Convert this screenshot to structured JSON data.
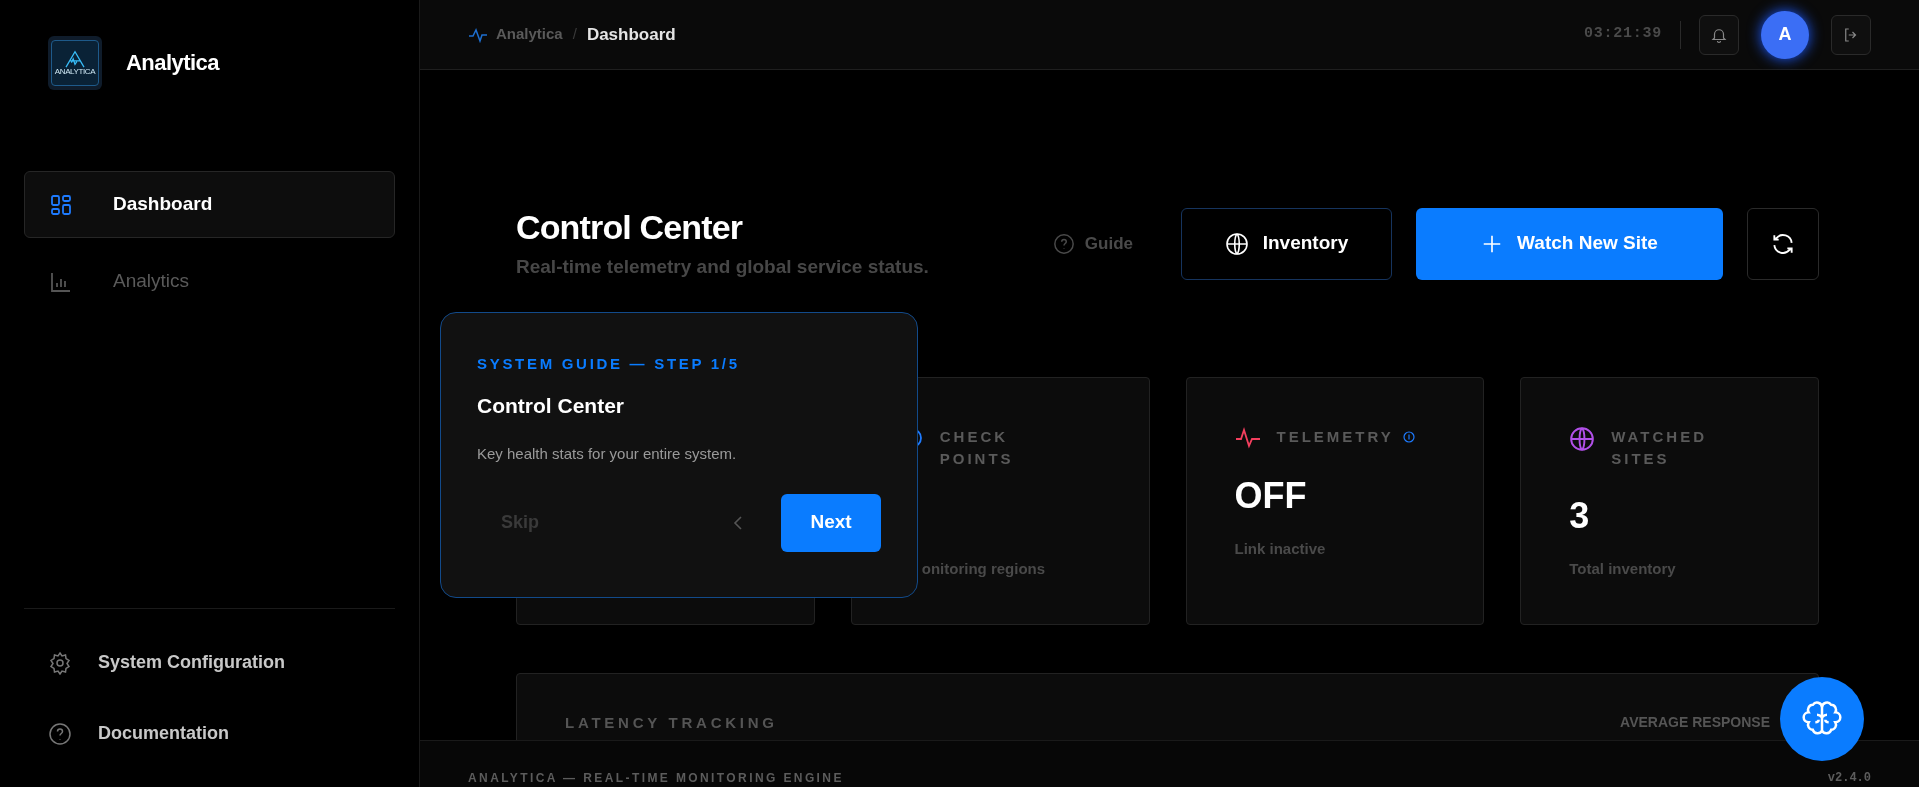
{
  "sidebar": {
    "brand": "Analytica",
    "logo_caption": "ANALYTICA",
    "nav": [
      {
        "label": "Dashboard",
        "selected": true
      },
      {
        "label": "Analytics",
        "selected": false
      }
    ],
    "bottom_links": [
      {
        "label": "System Configuration"
      },
      {
        "label": "Documentation"
      }
    ]
  },
  "header": {
    "breadcrumb": [
      "Analytica",
      "Dashboard"
    ],
    "separator": "/",
    "clock": "03:21:39",
    "avatar": "A"
  },
  "page": {
    "title": "Control Center",
    "subtitle": "Real-time telemetry and global service status.",
    "guide": "Guide",
    "inventory_button": "Inventory",
    "primary_button": "Watch New Site"
  },
  "stats": [
    {
      "kind": "covered"
    },
    {
      "kind": "stat",
      "label": "CHECK POINTS",
      "caption": "onitoring regions",
      "color": "#1e7bff",
      "info": false
    },
    {
      "kind": "stat",
      "label": "TELEMETRY",
      "value": "OFF",
      "caption": "Link inactive",
      "color": "#f43f5e",
      "info": true
    },
    {
      "kind": "stat",
      "label": "WATCHED SITES",
      "value": "3",
      "caption": "Total inventory",
      "color": "#b150e8",
      "info": false
    }
  ],
  "latency": {
    "title": "LATENCY TRACKING",
    "metric": "AVERAGE RESPONSE"
  },
  "footer": {
    "text": "ANALYTICA — REAL-TIME MONITORING ENGINE",
    "version": "v2.4.0"
  },
  "tour": {
    "step": "SYSTEM GUIDE — STEP 1/5",
    "title": "Control Center",
    "body": "Key health stats for your entire system.",
    "skip": "Skip",
    "next": "Next"
  }
}
